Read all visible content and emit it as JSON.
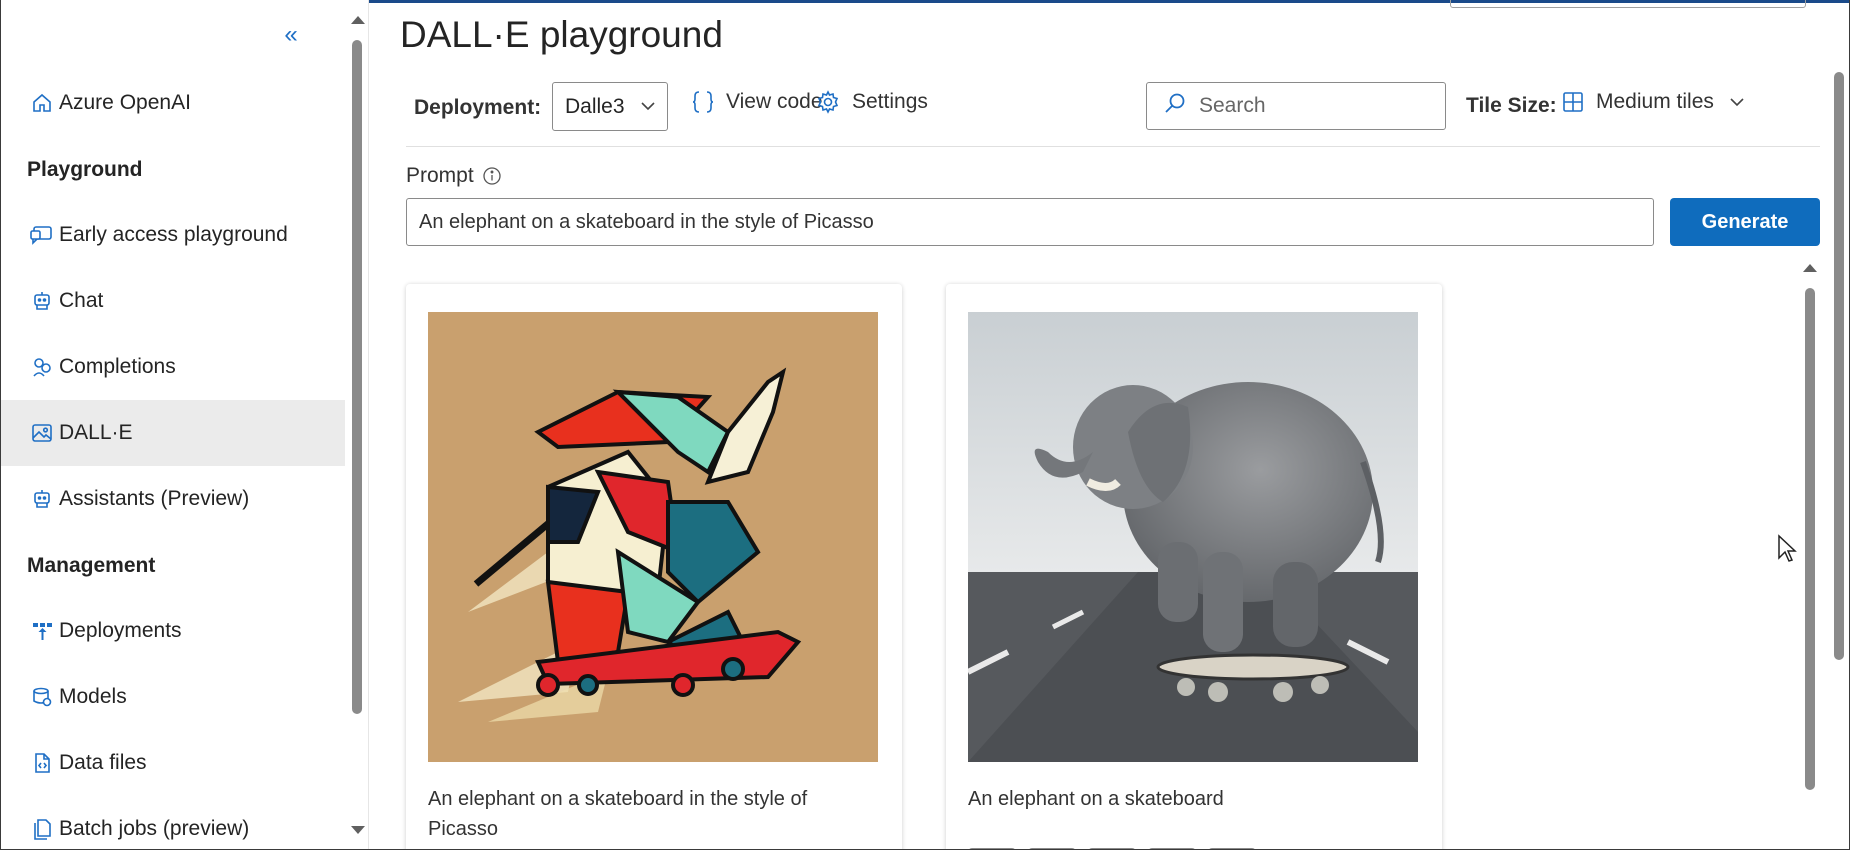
{
  "sidebar": {
    "collapse_glyph": "«",
    "items": [
      {
        "label": "Azure OpenAI",
        "icon": "home-icon"
      },
      {
        "label": "Early access playground",
        "icon": "chat-preview-icon"
      },
      {
        "label": "Chat",
        "icon": "bot-icon"
      },
      {
        "label": "Completions",
        "icon": "completions-icon"
      },
      {
        "label": "DALL·E",
        "icon": "image-icon",
        "active": true
      },
      {
        "label": "Assistants (Preview)",
        "icon": "bot-icon"
      },
      {
        "label": "Deployments",
        "icon": "deployments-icon"
      },
      {
        "label": "Models",
        "icon": "models-icon"
      },
      {
        "label": "Data files",
        "icon": "file-code-icon"
      },
      {
        "label": "Batch jobs (preview)",
        "icon": "batch-icon"
      }
    ],
    "headers": {
      "playground": "Playground",
      "management": "Management"
    }
  },
  "main": {
    "title": "DALL·E playground",
    "toolbar": {
      "deployment_label": "Deployment:",
      "deployment_value": "Dalle3",
      "view_code": "View code",
      "settings": "Settings",
      "search_placeholder": "Search",
      "tile_size_label": "Tile Size:",
      "tile_size_value": "Medium tiles"
    },
    "prompt": {
      "label": "Prompt",
      "value": "An elephant on a skateboard in the style of Picasso",
      "generate": "Generate"
    },
    "cards": [
      {
        "caption": "An elephant on a skateboard in the style of Picasso"
      },
      {
        "caption": "An elephant on a skateboard"
      }
    ]
  },
  "colors": {
    "accent": "#0f6cbd",
    "icon_blue": "#1f6fc5",
    "active_nav": "#ebebeb",
    "picasso_bg": "#c9a06e"
  }
}
